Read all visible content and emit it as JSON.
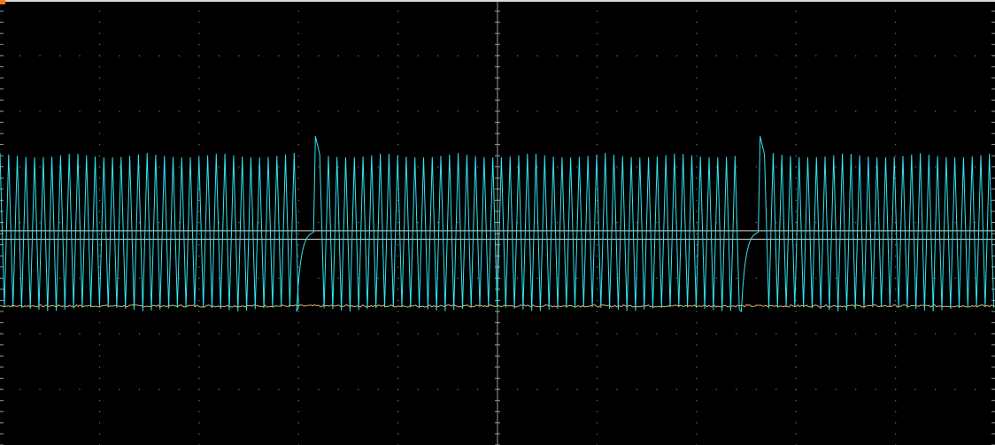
{
  "app": {
    "window": "oscilloscope-display"
  },
  "colors": {
    "background": "#000000",
    "frame": "#d9d9d9",
    "grid_dots": "#7a7a7a",
    "channel_1": "#2ee6f2",
    "channel_2": "#d8b070",
    "marker": "#f07818"
  },
  "screen": {
    "divisions_x": 10,
    "divisions_y": 8,
    "grid": true
  },
  "chart_data": {
    "type": "line",
    "xlabel": "",
    "ylabel": "",
    "xlim": [
      0,
      10
    ],
    "ylim": [
      -4,
      4
    ],
    "x_units": "div",
    "y_units": "div",
    "grid": true,
    "series": [
      {
        "channel": 1,
        "color": "#2ee6f2",
        "shape": "bursts of sharp oscillation with a short gap and exponential recovery repeating twice across the screen",
        "oscillation_cycles_per_div": 11.5,
        "peak_high": 1.25,
        "peak_low": -1.6,
        "burst_period": 4.47,
        "gap_start": [
          2.98,
          7.45
        ],
        "gap_width": 0.19,
        "recovery_level": -0.15,
        "overshoot_peak": 1.55
      },
      {
        "channel": 2,
        "color": "#d8b070",
        "shape": "flat low-level trace with slight noise",
        "level": -1.5
      }
    ],
    "reference_lines": [
      {
        "level": -0.15,
        "color": "#d8d8c8"
      },
      {
        "level": -0.3,
        "color": "#d8d8c8"
      }
    ]
  }
}
